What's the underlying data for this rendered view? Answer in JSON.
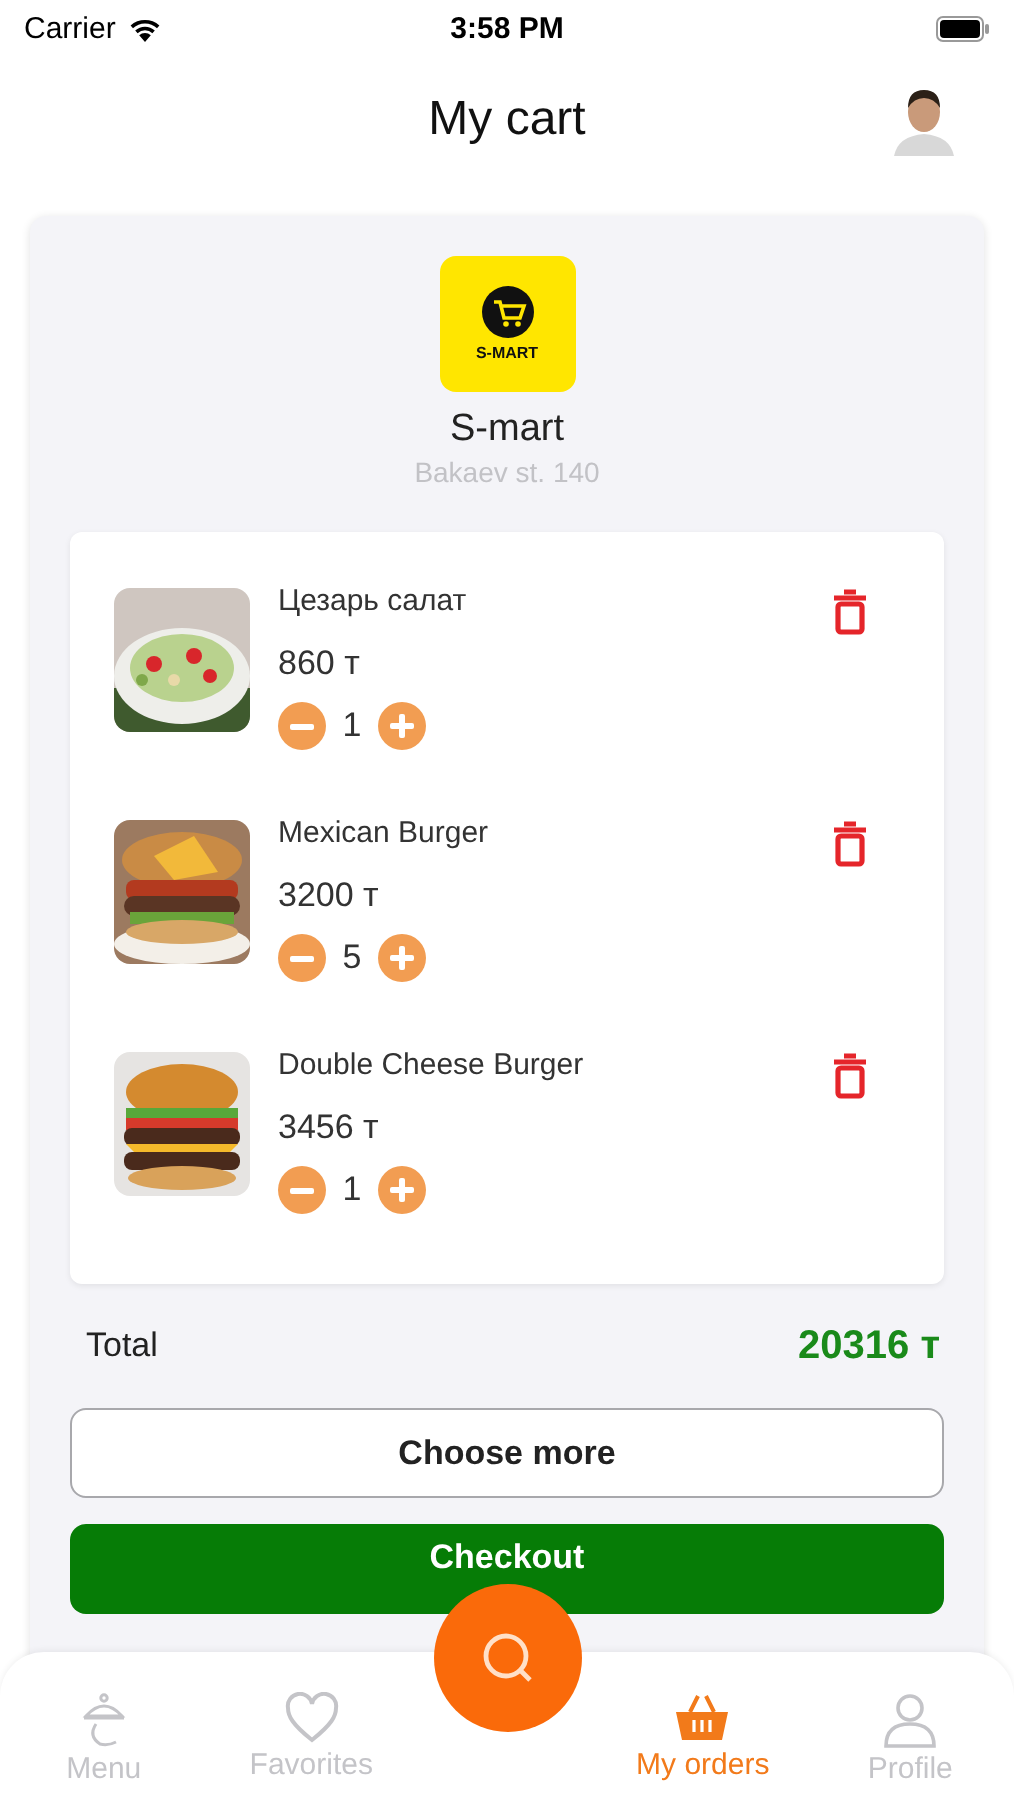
{
  "status_bar": {
    "carrier": "Carrier",
    "time": "3:58 PM"
  },
  "header": {
    "title": "My cart"
  },
  "store": {
    "logo_text": "S-MART",
    "name": "S-mart",
    "address": "Bakaev st. 140"
  },
  "items": [
    {
      "name": "Цезарь салат",
      "price": "860 т",
      "quantity": "1"
    },
    {
      "name": "Mexican Burger",
      "price": "3200 т",
      "quantity": "5"
    },
    {
      "name": "Double Cheese Burger",
      "price": "3456 т",
      "quantity": "1"
    }
  ],
  "total": {
    "label": "Total",
    "value": "20316 т"
  },
  "buttons": [
    {
      "label": "Choose more",
      "kind": "outline"
    },
    {
      "label": "Checkout",
      "kind": "primary"
    }
  ],
  "nav": {
    "items": [
      {
        "label": "Menu",
        "selected": false
      },
      {
        "label": "Favorites",
        "selected": false
      },
      {
        "label": "My orders",
        "selected": true
      },
      {
        "label": "Profile",
        "selected": false
      }
    ]
  }
}
